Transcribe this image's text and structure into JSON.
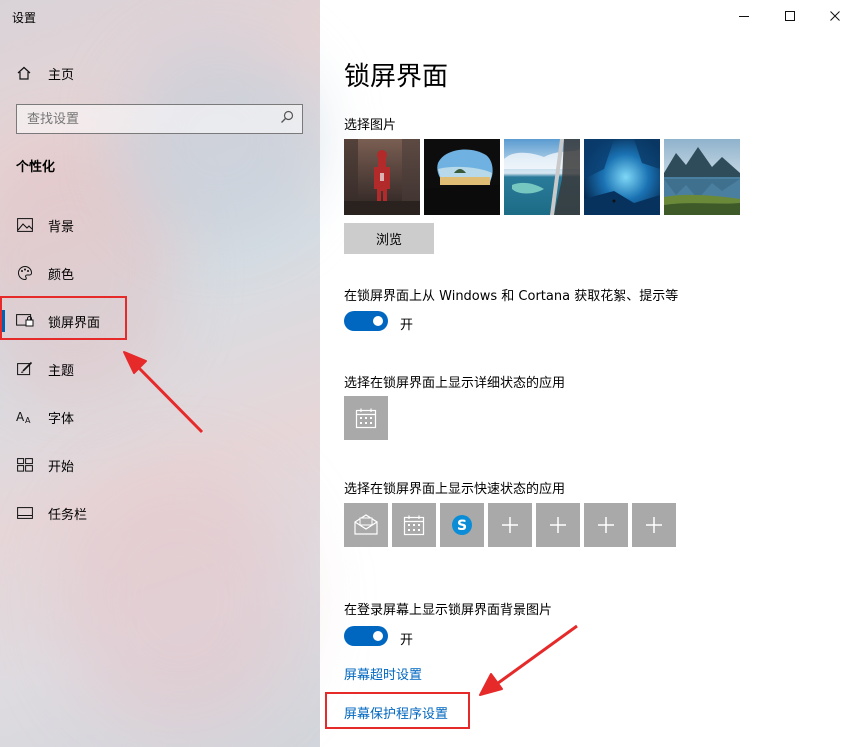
{
  "window": {
    "title": "设置"
  },
  "sidebar": {
    "home_label": "主页",
    "search_placeholder": "查找设置",
    "section_title": "个性化",
    "items": [
      {
        "label": "背景",
        "icon": "picture-icon"
      },
      {
        "label": "颜色",
        "icon": "palette-icon"
      },
      {
        "label": "锁屏界面",
        "icon": "lock-screen-icon",
        "active": true
      },
      {
        "label": "主题",
        "icon": "theme-brush-icon"
      },
      {
        "label": "字体",
        "icon": "font-icon"
      },
      {
        "label": "开始",
        "icon": "start-icon"
      },
      {
        "label": "任务栏",
        "icon": "taskbar-icon"
      }
    ]
  },
  "main": {
    "title": "锁屏界面",
    "choose_picture_label": "选择图片",
    "browse_label": "浏览",
    "fun_facts_label": "在锁屏界面上从 Windows 和 Cortana 获取花絮、提示等",
    "fun_facts_state": "开",
    "detailed_status_label": "选择在锁屏界面上显示详细状态的应用",
    "quick_status_label": "选择在锁屏界面上显示快速状态的应用",
    "signin_bg_label": "在登录屏幕上显示锁屏界面背景图片",
    "signin_bg_state": "开",
    "timeout_link": "屏幕超时设置",
    "screensaver_link": "屏幕保护程序设置"
  },
  "colors": {
    "accent": "#0067c0",
    "highlight": "#e62a2a",
    "tile": "#a9a9a9"
  }
}
